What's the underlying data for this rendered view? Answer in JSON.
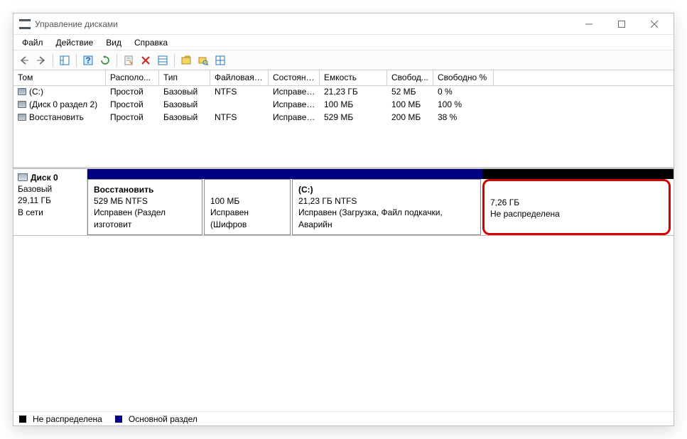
{
  "window": {
    "title": "Управление дисками"
  },
  "menu": {
    "file": "Файл",
    "action": "Действие",
    "view": "Вид",
    "help": "Справка"
  },
  "columns": [
    "Том",
    "Располо...",
    "Тип",
    "Файловая с...",
    "Состояние",
    "Емкость",
    "Свобод...",
    "Свободно %"
  ],
  "volumes": [
    {
      "name": "(C:)",
      "layout": "Простой",
      "type": "Базовый",
      "fs": "NTFS",
      "status": "Исправен...",
      "capacity": "21,23 ГБ",
      "free": "52 МБ",
      "freepct": "0 %"
    },
    {
      "name": "(Диск 0 раздел 2)",
      "layout": "Простой",
      "type": "Базовый",
      "fs": "",
      "status": "Исправен...",
      "capacity": "100 МБ",
      "free": "100 МБ",
      "freepct": "100 %"
    },
    {
      "name": "Восстановить",
      "layout": "Простой",
      "type": "Базовый",
      "fs": "NTFS",
      "status": "Исправен...",
      "capacity": "529 МБ",
      "free": "200 МБ",
      "freepct": "38 %"
    }
  ],
  "disk": {
    "name": "Диск 0",
    "type": "Базовый",
    "size": "29,11 ГБ",
    "status": "В сети",
    "partitions": [
      {
        "title": "Восстановить",
        "line2": "529 МБ NTFS",
        "line3": "Исправен (Раздел изготовит",
        "kind": "primary"
      },
      {
        "title": "",
        "line2": "100 МБ",
        "line3": "Исправен (Шифров",
        "kind": "primary"
      },
      {
        "title": "(C:)",
        "line2": "21,23 ГБ NTFS",
        "line3": "Исправен (Загрузка, Файл подкачки, Аварийн",
        "kind": "primary"
      },
      {
        "title": "",
        "line2": "7,26 ГБ",
        "line3": "Не распределена",
        "kind": "unallocated"
      }
    ]
  },
  "legend": {
    "unallocated": "Не распределена",
    "primary": "Основной раздел"
  }
}
